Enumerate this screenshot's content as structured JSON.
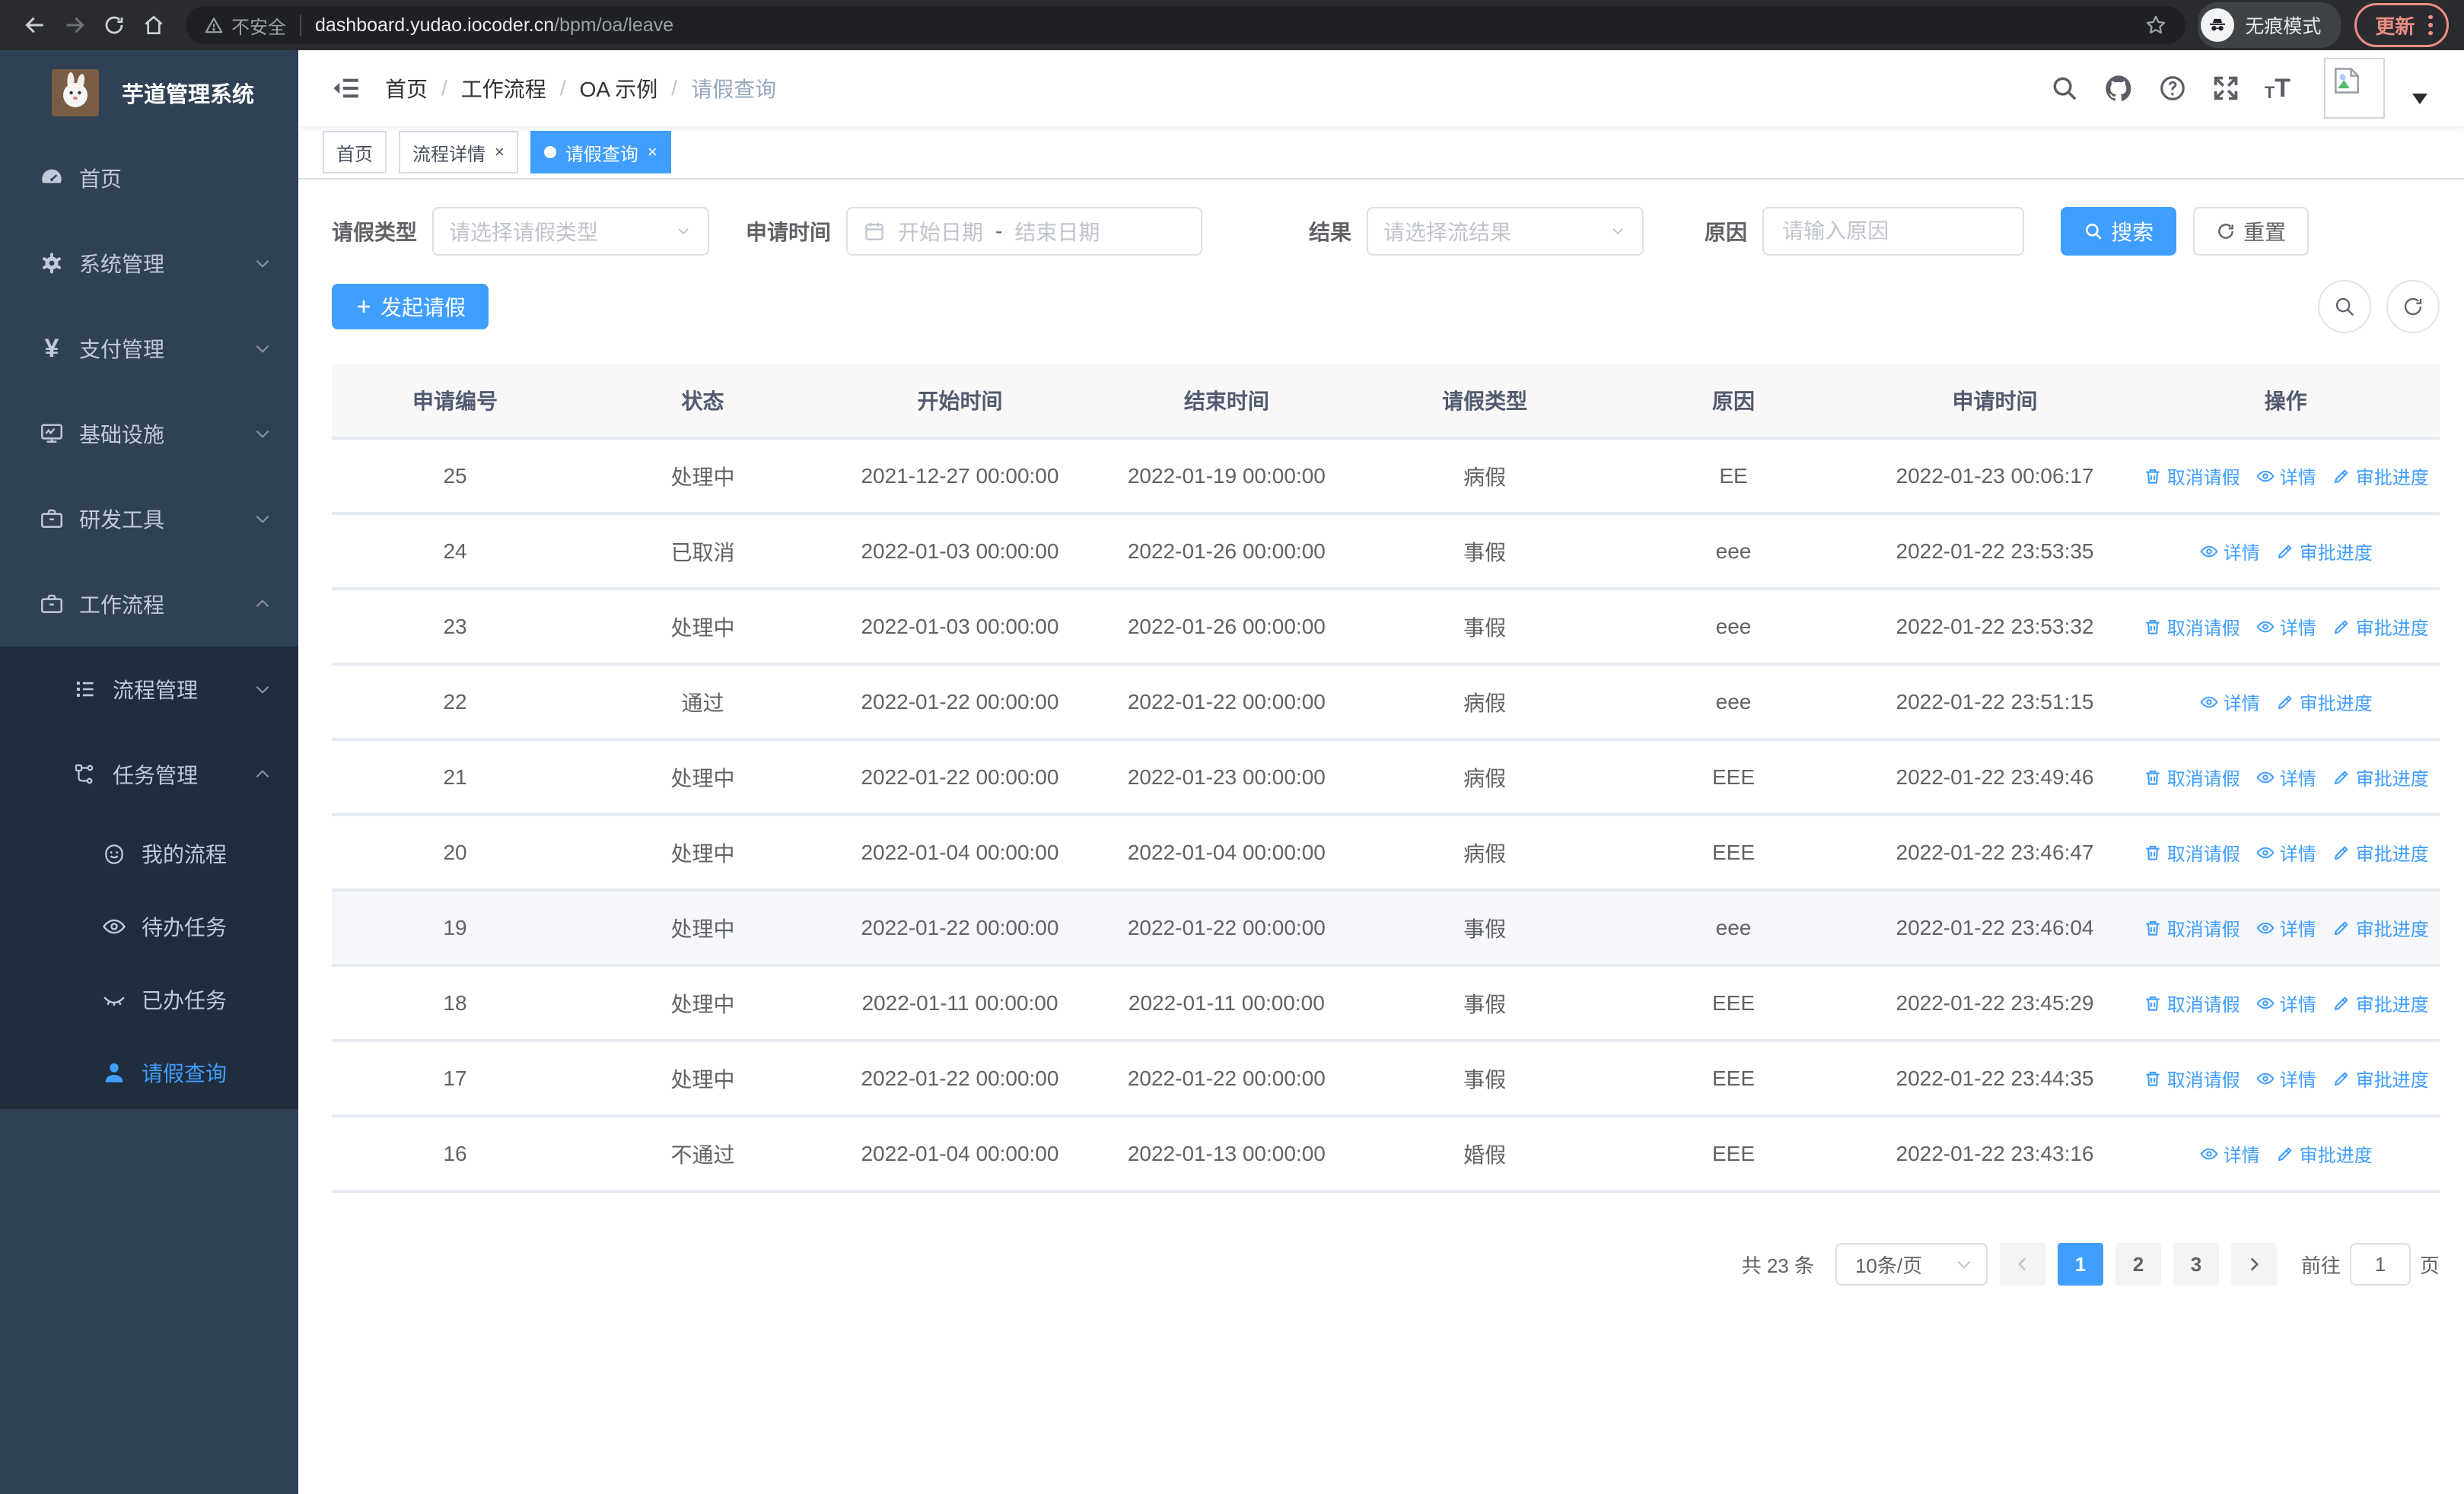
{
  "browser": {
    "security_label": "不安全",
    "url_host": "dashboard.yudao.iocoder.cn",
    "url_path": "/bpm/oa/leave",
    "incognito_label": "无痕模式",
    "update_label": "更新"
  },
  "sidebar": {
    "logo_title": "芋道管理系统",
    "items": [
      {
        "key": "home",
        "label": "首页",
        "icon": "dashboard",
        "level": 1,
        "zone": "top",
        "chevron": null,
        "active": false
      },
      {
        "key": "system",
        "label": "系统管理",
        "icon": "gear",
        "level": 1,
        "zone": "top",
        "chevron": "down",
        "active": false
      },
      {
        "key": "payment",
        "label": "支付管理",
        "icon": "yen",
        "level": 1,
        "zone": "top",
        "chevron": "down",
        "active": false
      },
      {
        "key": "infra",
        "label": "基础设施",
        "icon": "monitor",
        "level": 1,
        "zone": "top",
        "chevron": "down",
        "active": false
      },
      {
        "key": "devtools",
        "label": "研发工具",
        "icon": "briefcase",
        "level": 1,
        "zone": "top",
        "chevron": "down",
        "active": false
      },
      {
        "key": "workflow",
        "label": "工作流程",
        "icon": "briefcase",
        "level": 1,
        "zone": "top",
        "chevron": "up",
        "active": false
      },
      {
        "key": "process-mgmt",
        "label": "流程管理",
        "icon": "list",
        "level": 2,
        "zone": "sub",
        "chevron": "down",
        "active": false
      },
      {
        "key": "task-mgmt",
        "label": "任务管理",
        "icon": "flow",
        "level": 2,
        "zone": "sub",
        "chevron": "up",
        "active": false
      },
      {
        "key": "my-process",
        "label": "我的流程",
        "icon": "robot",
        "level": 3,
        "zone": "sub",
        "chevron": null,
        "active": false
      },
      {
        "key": "todo-tasks",
        "label": "待办任务",
        "icon": "eye",
        "level": 3,
        "zone": "sub",
        "chevron": null,
        "active": false
      },
      {
        "key": "done-tasks",
        "label": "已办任务",
        "icon": "eye-closed",
        "level": 3,
        "zone": "sub",
        "chevron": null,
        "active": false
      },
      {
        "key": "leave-query",
        "label": "请假查询",
        "icon": "user",
        "level": 3,
        "zone": "sub",
        "chevron": null,
        "active": true
      }
    ]
  },
  "breadcrumb": {
    "items": [
      "首页",
      "工作流程",
      "OA 示例",
      "请假查询"
    ]
  },
  "tabs": [
    {
      "label": "首页",
      "closable": false,
      "active": false
    },
    {
      "label": "流程详情",
      "closable": true,
      "active": false
    },
    {
      "label": "请假查询",
      "closable": true,
      "active": true
    }
  ],
  "filters": {
    "leave_type_label": "请假类型",
    "leave_type_placeholder": "请选择请假类型",
    "apply_time_label": "申请时间",
    "start_date_placeholder": "开始日期",
    "range_separator": "-",
    "end_date_placeholder": "结束日期",
    "result_label": "结果",
    "result_placeholder": "请选择流结果",
    "reason_label": "原因",
    "reason_placeholder": "请输入原因",
    "search_label": "搜索",
    "reset_label": "重置"
  },
  "toolbar": {
    "create_label": "发起请假"
  },
  "table": {
    "columns": [
      "申请编号",
      "状态",
      "开始时间",
      "结束时间",
      "请假类型",
      "原因",
      "申请时间",
      "操作"
    ],
    "action_labels": {
      "cancel": "取消请假",
      "detail": "详情",
      "progress": "审批进度"
    },
    "rows": [
      {
        "id": "25",
        "status": "处理中",
        "start": "2021-12-27 00:00:00",
        "end": "2022-01-19 00:00:00",
        "type": "病假",
        "reason": "EE",
        "applied": "2022-01-23 00:06:17",
        "actions": [
          "cancel",
          "detail",
          "progress"
        ],
        "hover": false
      },
      {
        "id": "24",
        "status": "已取消",
        "start": "2022-01-03 00:00:00",
        "end": "2022-01-26 00:00:00",
        "type": "事假",
        "reason": "eee",
        "applied": "2022-01-22 23:53:35",
        "actions": [
          "detail",
          "progress"
        ],
        "hover": false
      },
      {
        "id": "23",
        "status": "处理中",
        "start": "2022-01-03 00:00:00",
        "end": "2022-01-26 00:00:00",
        "type": "事假",
        "reason": "eee",
        "applied": "2022-01-22 23:53:32",
        "actions": [
          "cancel",
          "detail",
          "progress"
        ],
        "hover": false
      },
      {
        "id": "22",
        "status": "通过",
        "start": "2022-01-22 00:00:00",
        "end": "2022-01-22 00:00:00",
        "type": "病假",
        "reason": "eee",
        "applied": "2022-01-22 23:51:15",
        "actions": [
          "detail",
          "progress"
        ],
        "hover": false
      },
      {
        "id": "21",
        "status": "处理中",
        "start": "2022-01-22 00:00:00",
        "end": "2022-01-23 00:00:00",
        "type": "病假",
        "reason": "EEE",
        "applied": "2022-01-22 23:49:46",
        "actions": [
          "cancel",
          "detail",
          "progress"
        ],
        "hover": false
      },
      {
        "id": "20",
        "status": "处理中",
        "start": "2022-01-04 00:00:00",
        "end": "2022-01-04 00:00:00",
        "type": "病假",
        "reason": "EEE",
        "applied": "2022-01-22 23:46:47",
        "actions": [
          "cancel",
          "detail",
          "progress"
        ],
        "hover": false
      },
      {
        "id": "19",
        "status": "处理中",
        "start": "2022-01-22 00:00:00",
        "end": "2022-01-22 00:00:00",
        "type": "事假",
        "reason": "eee",
        "applied": "2022-01-22 23:46:04",
        "actions": [
          "cancel",
          "detail",
          "progress"
        ],
        "hover": true
      },
      {
        "id": "18",
        "status": "处理中",
        "start": "2022-01-11 00:00:00",
        "end": "2022-01-11 00:00:00",
        "type": "事假",
        "reason": "EEE",
        "applied": "2022-01-22 23:45:29",
        "actions": [
          "cancel",
          "detail",
          "progress"
        ],
        "hover": false
      },
      {
        "id": "17",
        "status": "处理中",
        "start": "2022-01-22 00:00:00",
        "end": "2022-01-22 00:00:00",
        "type": "事假",
        "reason": "EEE",
        "applied": "2022-01-22 23:44:35",
        "actions": [
          "cancel",
          "detail",
          "progress"
        ],
        "hover": false
      },
      {
        "id": "16",
        "status": "不通过",
        "start": "2022-01-04 00:00:00",
        "end": "2022-01-13 00:00:00",
        "type": "婚假",
        "reason": "EEE",
        "applied": "2022-01-22 23:43:16",
        "actions": [
          "detail",
          "progress"
        ],
        "hover": false
      }
    ]
  },
  "pagination": {
    "total_label": "共 23 条",
    "page_size": "10条/页",
    "pages": [
      "1",
      "2",
      "3"
    ],
    "active_page": "1",
    "prev_enabled": false,
    "next_enabled": true,
    "goto_label": "前往",
    "goto_value": "1",
    "page_unit": "页"
  },
  "colors": {
    "primary": "#409eff",
    "sidebar_bg": "#304156",
    "submenu_bg": "#1f2d3d",
    "link": "#409eff",
    "update_accent": "#ec8e84"
  }
}
